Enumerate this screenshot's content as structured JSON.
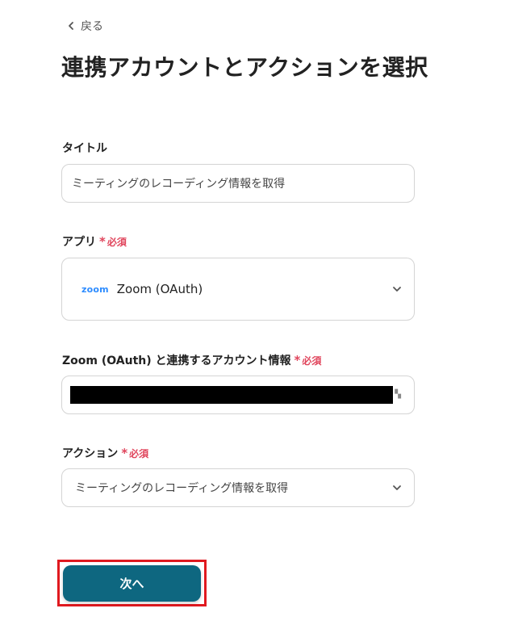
{
  "header": {
    "back_label": "戻る",
    "title": "連携アカウントとアクションを選択"
  },
  "required_label": "必須",
  "fields": {
    "title": {
      "label": "タイトル",
      "value": "ミーティングのレコーディング情報を取得"
    },
    "app": {
      "label": "アプリ",
      "logo_text": "zoom",
      "value": "Zoom (OAuth)"
    },
    "account": {
      "label": "Zoom (OAuth) と連携するアカウント情報"
    },
    "action": {
      "label": "アクション",
      "value": "ミーティングのレコーディング情報を取得"
    }
  },
  "next_label": "次へ",
  "colors": {
    "primary": "#0e6780",
    "required": "#e0455c",
    "zoom_blue": "#2d8cff",
    "highlight": "#e0191f"
  }
}
